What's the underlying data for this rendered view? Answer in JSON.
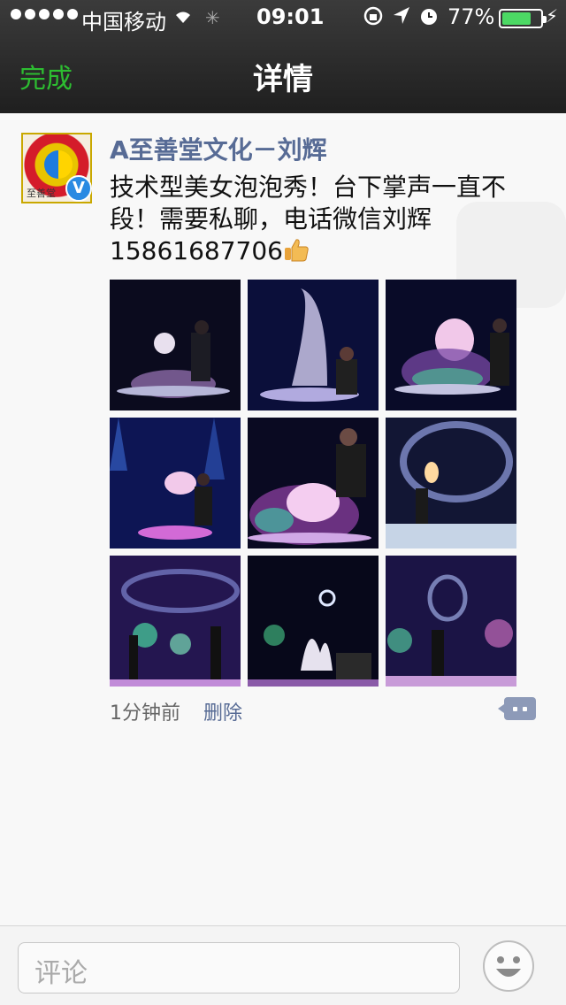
{
  "status_bar": {
    "carrier": "中国移动",
    "time": "09:01",
    "battery_percent": "77%",
    "battery_level": 0.77
  },
  "nav": {
    "done_label": "完成",
    "title": "详情"
  },
  "post": {
    "author": "A至善堂文化－刘辉",
    "text": "技术型美女泡泡秀！台下掌声一直不段！需要私聊，电话微信刘辉15861687706",
    "verified_badge": "V",
    "time_ago": "1分钟前",
    "delete_label": "删除",
    "images": [
      {
        "name": "photo-1"
      },
      {
        "name": "photo-2"
      },
      {
        "name": "photo-3"
      },
      {
        "name": "photo-4"
      },
      {
        "name": "photo-5"
      },
      {
        "name": "photo-6"
      },
      {
        "name": "photo-7"
      },
      {
        "name": "photo-8"
      },
      {
        "name": "photo-9"
      }
    ]
  },
  "comment_bar": {
    "placeholder": "评论"
  },
  "colors": {
    "accent_green": "#2dbd31",
    "link_blue": "#576b95",
    "battery_green": "#4cd964"
  }
}
